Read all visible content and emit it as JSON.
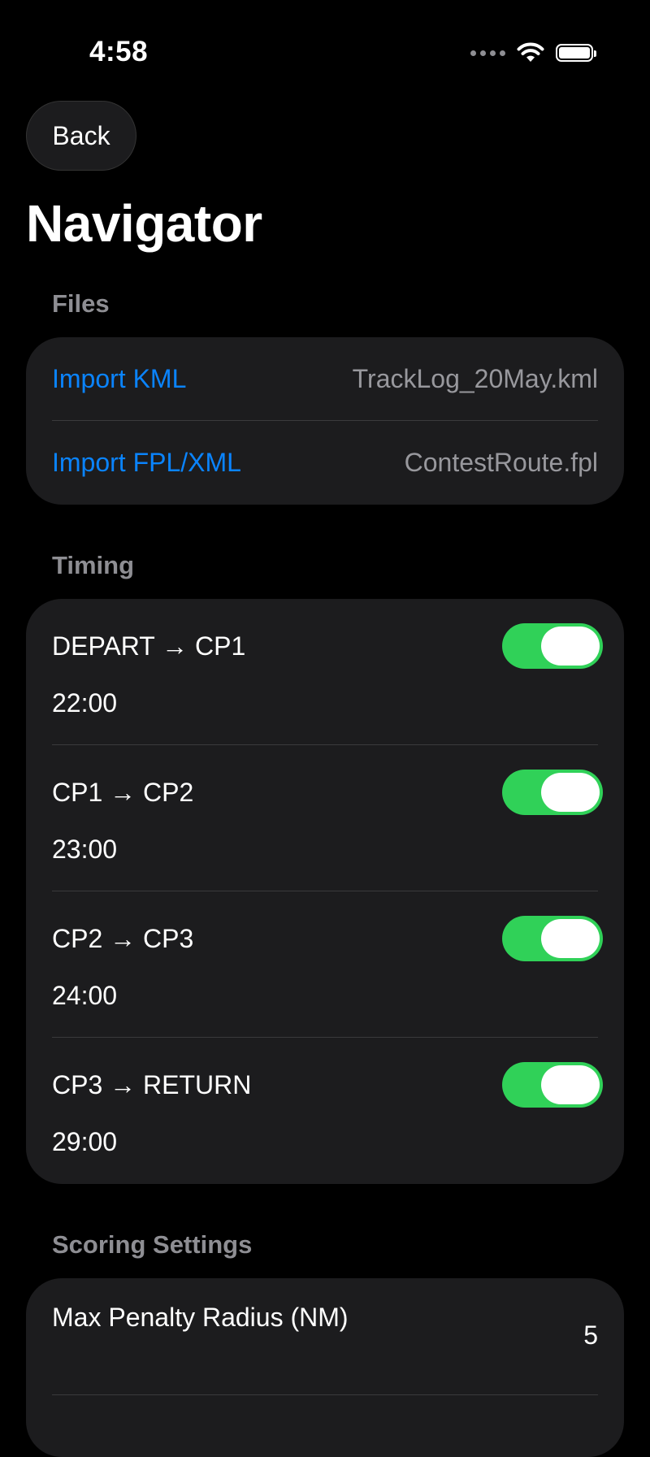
{
  "status_bar": {
    "time": "4:58",
    "icons": [
      "cellular-dots-icon",
      "wifi-icon",
      "battery-icon"
    ]
  },
  "nav": {
    "back_label": "Back",
    "title": "Navigator"
  },
  "files": {
    "header": "Files",
    "rows": [
      {
        "label": "Import KML",
        "value": "TrackLog_20May.kml"
      },
      {
        "label": "Import FPL/XML",
        "value": "ContestRoute.fpl"
      }
    ]
  },
  "timing": {
    "header": "Timing",
    "legs": [
      {
        "leg": "DEPART → CP1",
        "time": "22:00",
        "enabled": true
      },
      {
        "leg": "CP1 → CP2",
        "time": "23:00",
        "enabled": true
      },
      {
        "leg": "CP2 → CP3",
        "time": "24:00",
        "enabled": true
      },
      {
        "leg": "CP3 → RETURN",
        "time": "29:00",
        "enabled": true
      }
    ]
  },
  "scoring": {
    "header": "Scoring Settings",
    "rows": [
      {
        "label": "Max Penalty Radius (NM)",
        "value": "5"
      }
    ]
  },
  "colors": {
    "accent": "#0a84ff",
    "toggle_on": "#30d158",
    "card_bg": "#1c1c1e",
    "secondary_text": "#8e8e93"
  }
}
